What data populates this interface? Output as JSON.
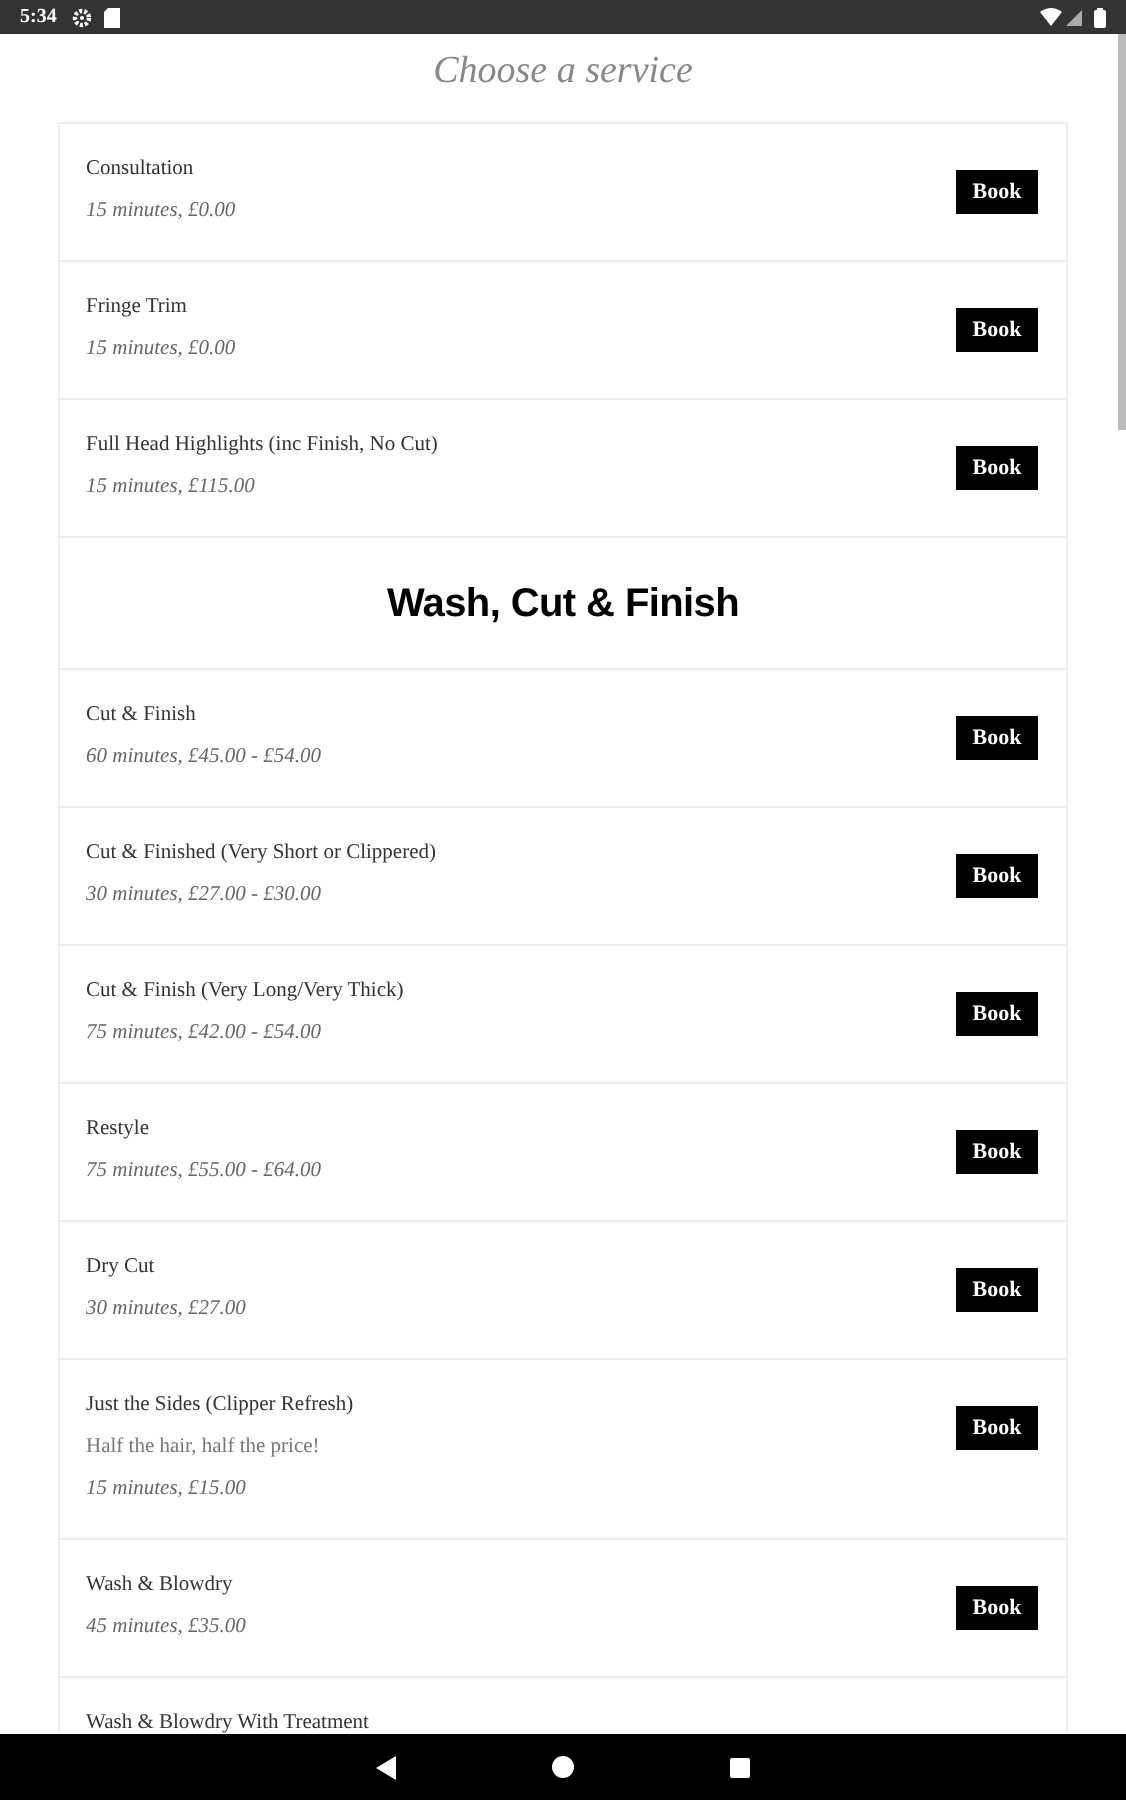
{
  "status_bar": {
    "time": "5:34"
  },
  "title": "Choose a service",
  "sections": [
    {
      "services": [
        {
          "name": "Consultation",
          "details": "15 minutes, £0.00",
          "button": "Book"
        },
        {
          "name": "Fringe Trim",
          "details": "15 minutes, £0.00",
          "button": "Book"
        },
        {
          "name": "Full Head Highlights (inc Finish, No Cut)",
          "details": "15 minutes, £115.00",
          "button": "Book"
        }
      ]
    },
    {
      "heading": "Wash, Cut & Finish",
      "services": [
        {
          "name": "Cut & Finish",
          "details": "60 minutes, £45.00 - £54.00",
          "button": "Book"
        },
        {
          "name": "Cut & Finished (Very Short or Clippered)",
          "details": "30 minutes, £27.00 - £30.00",
          "button": "Book"
        },
        {
          "name": "Cut & Finish (Very Long/Very Thick)",
          "details": "75 minutes, £42.00 - £54.00",
          "button": "Book"
        },
        {
          "name": "Restyle",
          "details": "75 minutes, £55.00 - £64.00",
          "button": "Book"
        },
        {
          "name": "Dry Cut",
          "details": "30 minutes, £27.00",
          "button": "Book"
        },
        {
          "name": "Just the Sides (Clipper Refresh)",
          "description": "Half the hair, half the price!",
          "details": "15 minutes, £15.00",
          "button": "Book"
        },
        {
          "name": "Wash & Blowdry",
          "details": "45 minutes, £35.00",
          "button": "Book"
        },
        {
          "name": "Wash & Blowdry With Treatment"
        }
      ]
    }
  ]
}
